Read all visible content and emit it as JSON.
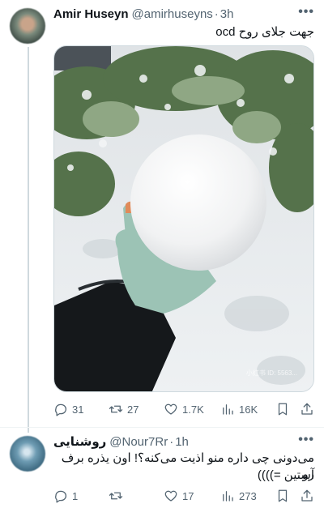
{
  "tweet1": {
    "name": "Amir Huseyn",
    "handle": "@amirhuseyns",
    "time": "3h",
    "text": "جهت جلای روح ocd",
    "media_watermark": "小红书 ID: 5563...",
    "stats": {
      "replies": "31",
      "reposts": "27",
      "likes": "1.7K",
      "views": "16K"
    }
  },
  "tweet2": {
    "name": "روشنایی",
    "handle": "@Nour7Rr",
    "time": "1h",
    "text_line1": "می‌دونی چی داره منو اذیت می‌کنه؟! اون یذره برف رو",
    "text_line2": "آستین =))))",
    "stats": {
      "replies": "1",
      "reposts": "",
      "likes": "17",
      "views": "273"
    }
  },
  "ui": {
    "dot": "·",
    "more": "•••"
  },
  "icons": [
    "reply-icon",
    "repost-icon",
    "like-icon",
    "views-icon",
    "bookmark-icon",
    "share-icon",
    "more-icon"
  ]
}
